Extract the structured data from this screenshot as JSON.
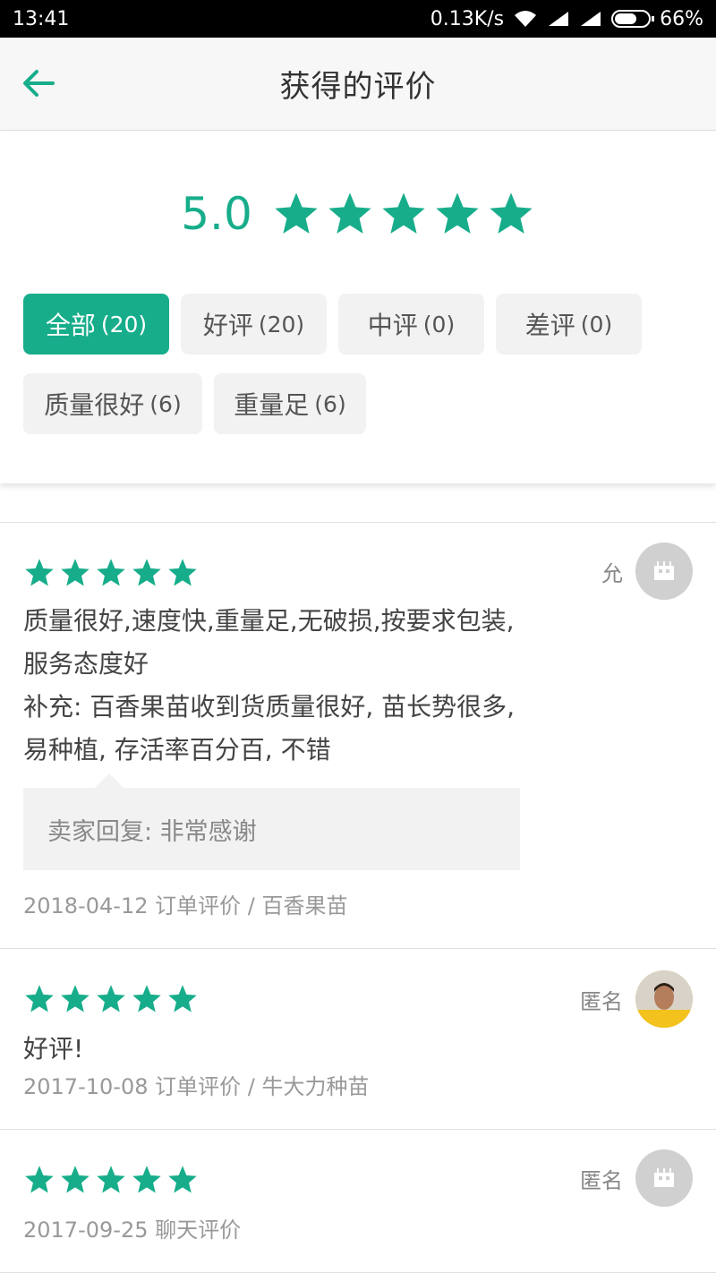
{
  "status_bar": {
    "time": "13:41",
    "network_speed": "0.13K/s",
    "battery": "66%",
    "battery_level": 0.66,
    "icons": [
      "wifi-icon",
      "signal-icon",
      "signal-icon",
      "battery-icon"
    ]
  },
  "header": {
    "title": "获得的评价",
    "back_icon": "back-arrow-icon"
  },
  "summary": {
    "score": "5.0",
    "stars": 5,
    "accent_color": "#17ad8b"
  },
  "tags": [
    {
      "label": "全部",
      "count": "(20)",
      "active": true
    },
    {
      "label": "好评",
      "count": "(20)",
      "active": false
    },
    {
      "label": "中评",
      "count": "(0)",
      "active": false
    },
    {
      "label": "差评",
      "count": "(0)",
      "active": false
    },
    {
      "label": "质量很好",
      "count": "(6)",
      "active": false
    },
    {
      "label": "重量足",
      "count": "(6)",
      "active": false
    }
  ],
  "reviews": [
    {
      "stars": 5,
      "user": "允",
      "avatar": "store-icon",
      "text": "质量很好,速度快,重量足,无破损,按要求包装,服务态度好",
      "supplement": "补充: 百香果苗收到货质量很好, 苗长势很多, 易种植, 存活率百分百, 不错",
      "reply": "卖家回复: 非常感谢",
      "meta": "2018-04-12 订单评价 / 百香果苗"
    },
    {
      "stars": 5,
      "user": "匿名",
      "avatar": "user-photo",
      "text": "好评!",
      "meta": "2017-10-08 订单评价 / 牛大力种苗"
    },
    {
      "stars": 5,
      "user": "匿名",
      "avatar": "store-icon",
      "meta": "2017-09-25 聊天评价"
    }
  ]
}
